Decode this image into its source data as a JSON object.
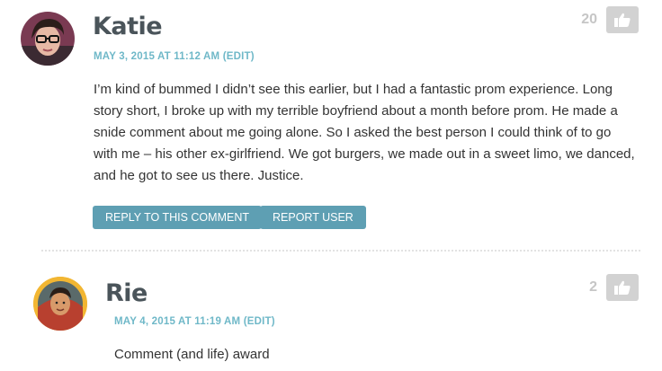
{
  "comments": [
    {
      "author": "Katie",
      "date": "MAY 3, 2015 AT 11:12 AM",
      "edit": "(EDIT)",
      "likes": "20",
      "avatar": "katie-avatar",
      "body_lines": [
        "I’m kind of bummed I didn’t see this earlier, but I had a fantastic prom experience. Long",
        "story short, I broke up with my terrible boyfriend about a month before prom. He made a",
        "snide comment about me going alone. So I asked the best person I could think of to go",
        "with me – his other ex-girlfriend. We got burgers, we made out in a sweet limo, we danced,",
        "and he got to see us there. Justice."
      ],
      "reply_label": "REPLY TO THIS COMMENT",
      "report_label": "REPORT USER"
    },
    {
      "author": "Rie",
      "date": "MAY 4, 2015 AT 11:19 AM",
      "edit": "(EDIT)",
      "likes": "2",
      "avatar": "rie-avatar",
      "body_lines": [
        "Comment (and life) award"
      ]
    }
  ],
  "colors": {
    "accent_text": "#6fb8c8",
    "button_bg": "#5e9fb3",
    "like_bg": "#d2d2d2",
    "avatar_ring": "#f2b632"
  },
  "icons": {
    "like": "thumbs-up-icon"
  }
}
